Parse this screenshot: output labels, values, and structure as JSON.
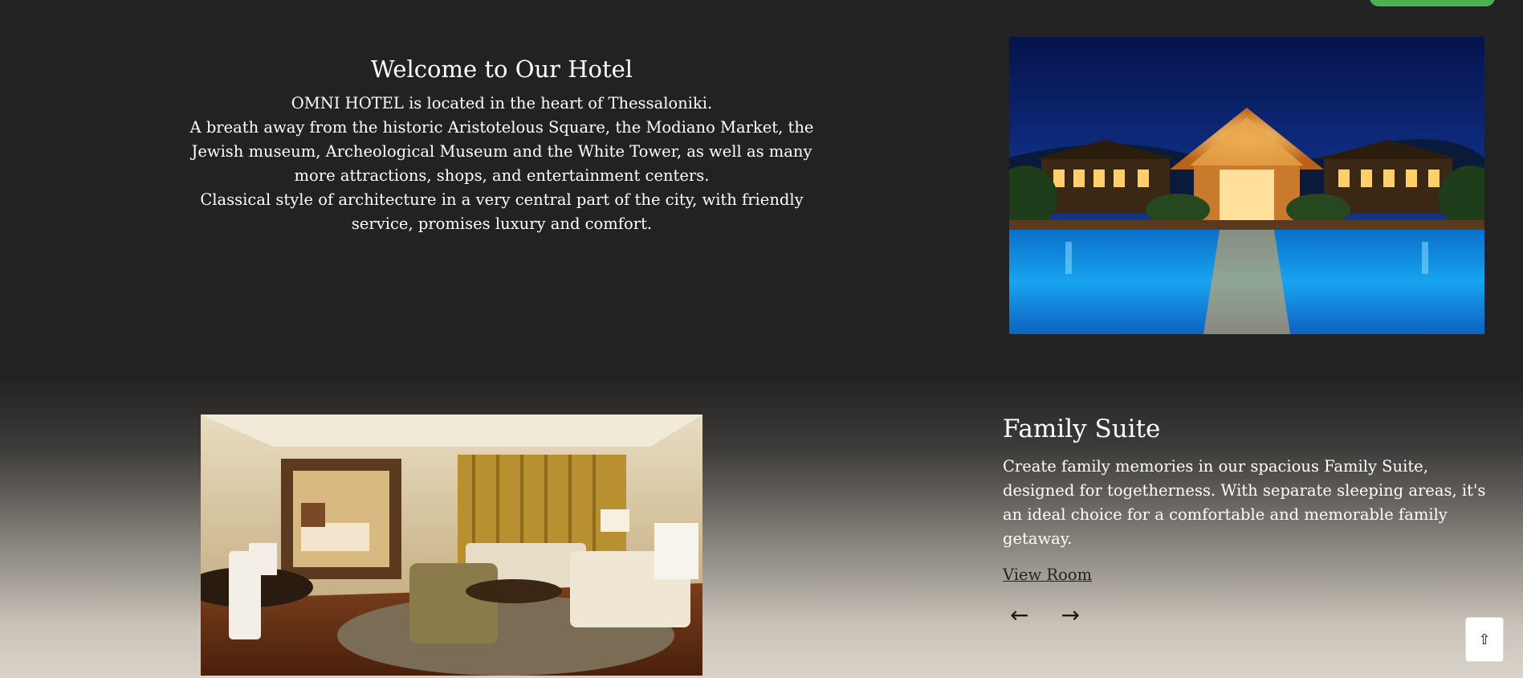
{
  "welcome": {
    "title": "Welcome to Our Hotel",
    "line1": "OMNI HOTEL is located in the heart of Thessaloniki.",
    "line2": "A breath away from the historic Aristotelous Square, the Modiano Market, the Jewish museum, Archeological Museum and the White Tower, as well as many more attractions, shops, and entertainment centers.",
    "line3": "Classical style of architecture in a very central part of the city, with friendly service, promises luxury and comfort."
  },
  "hero_image": {
    "icon": "hotel-pool-night-photo"
  },
  "room": {
    "image_icon": "family-suite-room-photo",
    "title": "Family Suite",
    "description": "Create family memories in our spacious Family Suite, designed for togetherness. With separate sleeping areas, it's an ideal choice for a comfortable and memorable family getaway.",
    "link_label": "View Room",
    "prev_arrow": "←",
    "next_arrow": "→"
  },
  "scroll_top": {
    "glyph": "⇧"
  },
  "colors": {
    "background": "#222222",
    "accent_green": "#4caf50",
    "text_light": "#ffffff",
    "text_dark": "#222222"
  }
}
